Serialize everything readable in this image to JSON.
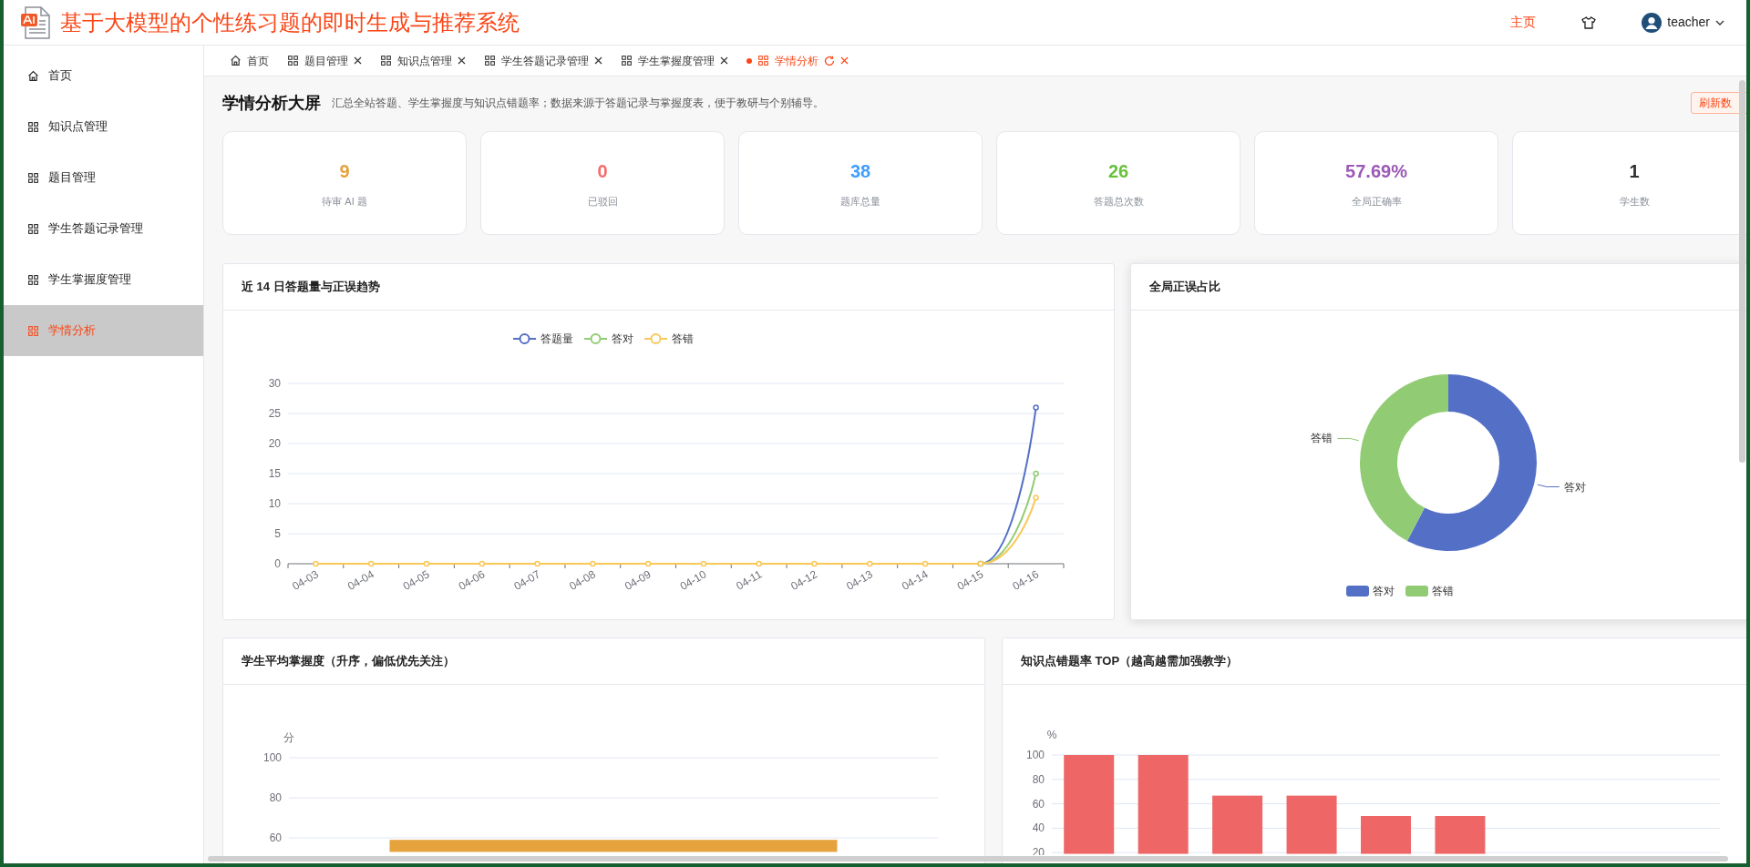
{
  "header": {
    "title": "基于大模型的个性练习题的即时生成与推荐系统",
    "nav_link": "主页",
    "user": "teacher"
  },
  "sidebar": {
    "items": [
      {
        "label": "首页",
        "kind": "home",
        "selected": false
      },
      {
        "label": "知识点管理",
        "kind": "apps",
        "selected": false
      },
      {
        "label": "题目管理",
        "kind": "apps",
        "selected": false
      },
      {
        "label": "学生答题记录管理",
        "kind": "apps",
        "selected": false
      },
      {
        "label": "学生掌握度管理",
        "kind": "apps",
        "selected": false
      },
      {
        "label": "学情分析",
        "kind": "apps",
        "selected": true
      }
    ]
  },
  "tabs": [
    {
      "label": "首页",
      "kind": "home",
      "selected": false,
      "closable": false
    },
    {
      "label": "题目管理",
      "kind": "apps",
      "selected": false,
      "closable": true
    },
    {
      "label": "知识点管理",
      "kind": "apps",
      "selected": false,
      "closable": true
    },
    {
      "label": "学生答题记录管理",
      "kind": "apps",
      "selected": false,
      "closable": true
    },
    {
      "label": "学生掌握度管理",
      "kind": "apps",
      "selected": false,
      "closable": true
    },
    {
      "label": "学情分析",
      "kind": "apps",
      "selected": true,
      "closable": true
    }
  ],
  "page": {
    "title": "学情分析大屏",
    "description": "汇总全站答题、学生掌握度与知识点错题率；数据来源于答题记录与掌握度表，便于教研与个别辅导。",
    "refresh_button": "刷新数"
  },
  "stats": [
    {
      "value": "9",
      "label": "待审 AI 题",
      "color": "#e6a23c"
    },
    {
      "value": "0",
      "label": "已驳回",
      "color": "#f56c6c"
    },
    {
      "value": "38",
      "label": "题库总量",
      "color": "#409eff"
    },
    {
      "value": "26",
      "label": "答题总次数",
      "color": "#67c23a"
    },
    {
      "value": "57.69%",
      "label": "全局正确率",
      "color": "#9b59b6"
    },
    {
      "value": "1",
      "label": "学生数",
      "color": "#303133"
    }
  ],
  "trend": {
    "title": "近 14 日答题量与正误趋势",
    "chart_data": {
      "type": "line",
      "categories": [
        "04-03",
        "04-04",
        "04-05",
        "04-06",
        "04-07",
        "04-08",
        "04-09",
        "04-10",
        "04-11",
        "04-12",
        "04-13",
        "04-14",
        "04-15",
        "04-16"
      ],
      "series": [
        {
          "name": "答题量",
          "color": "#5470c6",
          "marker": "circle",
          "values": [
            null,
            null,
            null,
            null,
            null,
            null,
            null,
            null,
            null,
            null,
            null,
            null,
            0,
            26
          ]
        },
        {
          "name": "答对",
          "color": "#91cc75",
          "marker": "circle",
          "values": [
            null,
            null,
            null,
            null,
            null,
            null,
            null,
            null,
            null,
            null,
            null,
            null,
            0,
            15
          ]
        },
        {
          "name": "答错",
          "color": "#fac858",
          "marker": "circle",
          "values": [
            0,
            0,
            0,
            0,
            0,
            0,
            0,
            0,
            0,
            0,
            0,
            0,
            0,
            11
          ]
        }
      ],
      "ylim": [
        0,
        30
      ],
      "yticks": [
        0,
        5,
        10,
        15,
        20,
        25,
        30
      ],
      "grid": true,
      "legend": true
    }
  },
  "ratio": {
    "title": "全局正误占比",
    "chart_data": {
      "type": "donut",
      "categories": [
        "答对",
        "答错"
      ],
      "values": [
        57.69,
        42.31
      ],
      "legend": true
    }
  },
  "mastery": {
    "title": "学生平均掌握度（升序，偏低优先关注）",
    "chart_data": {
      "type": "bar",
      "ylabel": "分",
      "values": [
        59
      ],
      "ylim": [
        53,
        100
      ],
      "yticks": [
        60,
        80,
        100
      ],
      "grid": true
    }
  },
  "error_rate": {
    "title": "知识点错题率 TOP（越高越需加强教学）",
    "chart_data": {
      "type": "bar",
      "ylabel": "%",
      "values": [
        100,
        100,
        66.7,
        66.7,
        50,
        50,
        null,
        null,
        null
      ],
      "ylim": [
        19,
        100
      ],
      "yticks": [
        20,
        40,
        60,
        80,
        100
      ],
      "grid": true
    }
  }
}
